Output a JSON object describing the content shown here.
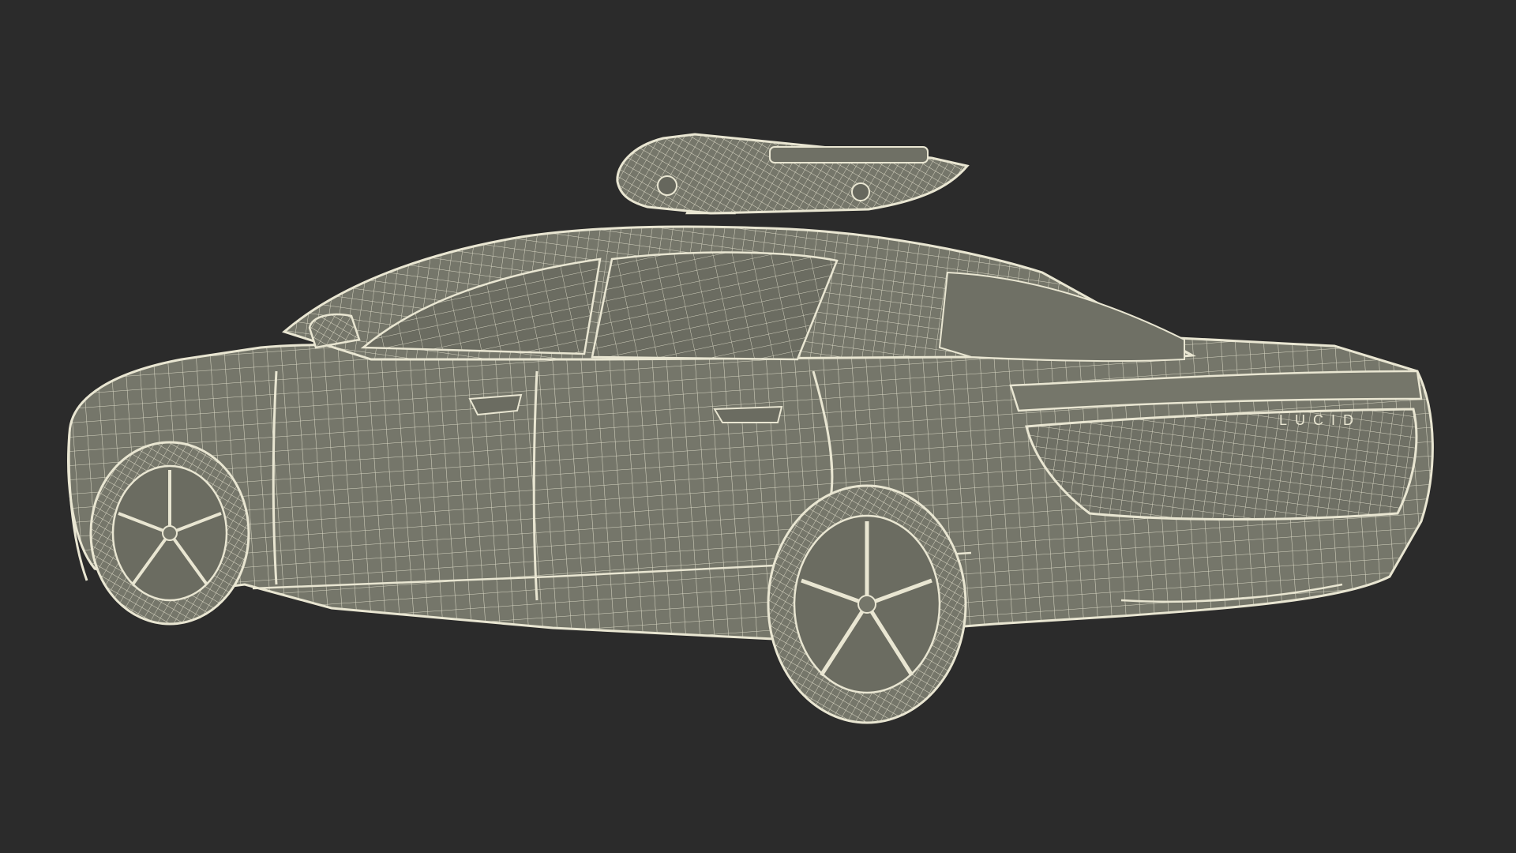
{
  "scene": {
    "background_color": "#2b2b2b",
    "surface_color": "#75766a",
    "surface_shadow_color": "#5f6057",
    "wire_color": "#e9e6d2",
    "subject": "wireframe-sedan-with-roof-sensor"
  },
  "badge": {
    "rear_lettering": "LUCID"
  }
}
